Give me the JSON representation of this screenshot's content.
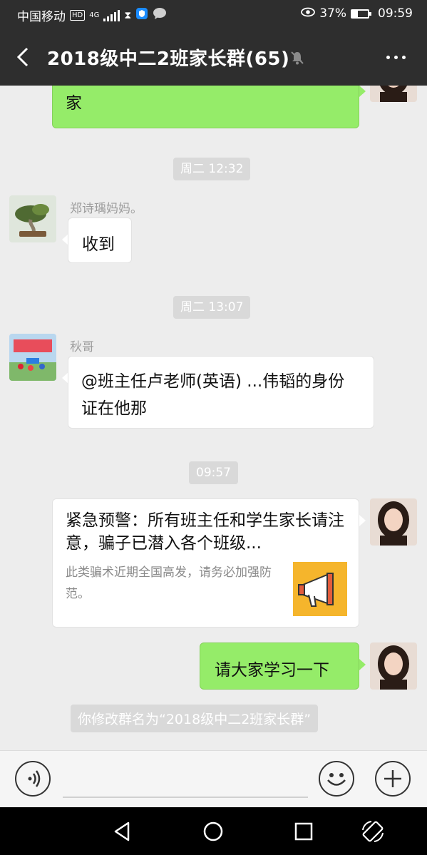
{
  "status": {
    "carrier": "中国移动",
    "hd": "HD",
    "network": "4G",
    "battery_pct": "37%",
    "battery_level": 0.37,
    "time": "09:59"
  },
  "header": {
    "title": "2018级中二2班家长群(65)"
  },
  "messages": {
    "top_partial": "家",
    "time1": "周二 12:32",
    "sender1": "郑诗瑀妈妈。",
    "msg1": "收到",
    "time2": "周二 13:07",
    "sender2": "秋哥",
    "msg2": "@班主任卢老师(英语) ...伟韬的身份证在他那",
    "time3": "09:57",
    "card": {
      "title": "紧急预警：所有班主任和学生家长请注意，骗子已潜入各个班级...",
      "desc": "此类骗术近期全国高发，请务必加强防范。",
      "thumb_icon": "megaphone-icon"
    },
    "msg3": "请大家学习一下",
    "system": "你修改群名为“2018级中二2班家长群”"
  },
  "colors": {
    "bar": "#2e2e2e",
    "bg": "#ededed",
    "green_bubble": "#95ec69",
    "thumb_bg": "#f5b52c"
  }
}
